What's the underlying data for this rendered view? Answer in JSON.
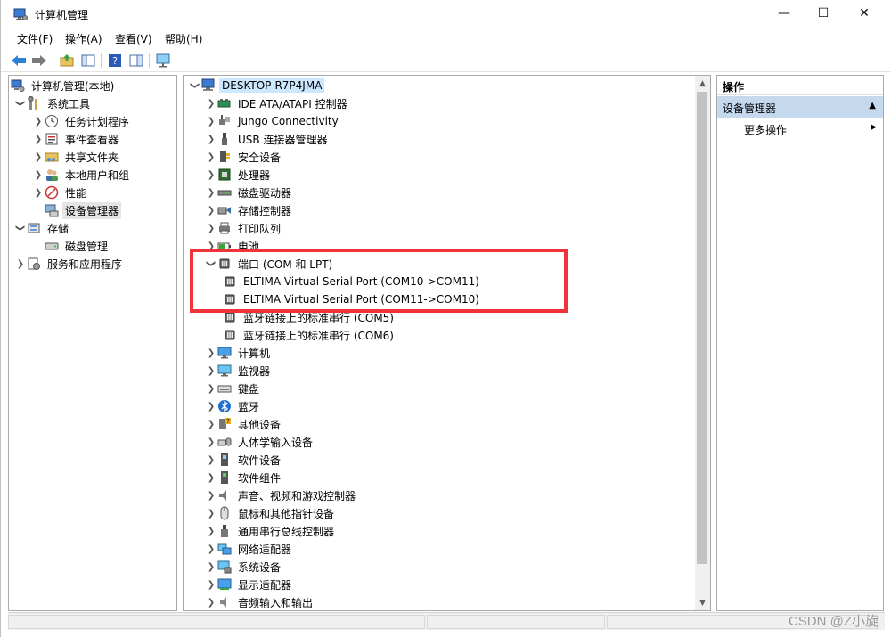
{
  "window": {
    "title": "计算机管理",
    "controls": {
      "minimize": "—",
      "maximize": "☐",
      "close": "✕"
    }
  },
  "menu": [
    "文件(F)",
    "操作(A)",
    "查看(V)",
    "帮助(H)"
  ],
  "toolbar": {
    "icons": [
      "back-arrow-icon",
      "forward-arrow-icon",
      "up-folder-icon",
      "show-hide-tree-icon",
      "help-icon",
      "properties-icon",
      "monitor-icon"
    ]
  },
  "left_tree": [
    {
      "label": "计算机管理(本地)",
      "icon": "computer-manage-icon",
      "level": 0,
      "chevron": "",
      "selected": false
    },
    {
      "label": "系统工具",
      "icon": "tools-icon",
      "level": 1,
      "chevron": "v",
      "selected": false
    },
    {
      "label": "任务计划程序",
      "icon": "clock-icon",
      "level": 2,
      "chevron": ">",
      "selected": false
    },
    {
      "label": "事件查看器",
      "icon": "event-viewer-icon",
      "level": 2,
      "chevron": ">",
      "selected": false
    },
    {
      "label": "共享文件夹",
      "icon": "shared-folder-icon",
      "level": 2,
      "chevron": ">",
      "selected": false
    },
    {
      "label": "本地用户和组",
      "icon": "users-icon",
      "level": 2,
      "chevron": ">",
      "selected": false
    },
    {
      "label": "性能",
      "icon": "performance-icon",
      "level": 2,
      "chevron": ">",
      "selected": false
    },
    {
      "label": "设备管理器",
      "icon": "device-manager-icon",
      "level": 2,
      "chevron": "",
      "selected": true
    },
    {
      "label": "存储",
      "icon": "storage-icon",
      "level": 1,
      "chevron": "v",
      "selected": false
    },
    {
      "label": "磁盘管理",
      "icon": "disk-icon",
      "level": 2,
      "chevron": "",
      "selected": false
    },
    {
      "label": "服务和应用程序",
      "icon": "services-icon",
      "level": 1,
      "chevron": ">",
      "selected": false
    }
  ],
  "device_tree": {
    "root": "DESKTOP-R7P4JMA",
    "items": [
      {
        "label": "IDE ATA/ATAPI 控制器",
        "icon": "ide-icon",
        "level": 1,
        "chevron": ">"
      },
      {
        "label": "Jungo Connectivity",
        "icon": "jungo-icon",
        "level": 1,
        "chevron": ">"
      },
      {
        "label": "USB 连接器管理器",
        "icon": "usb-icon",
        "level": 1,
        "chevron": ">"
      },
      {
        "label": "安全设备",
        "icon": "security-icon",
        "level": 1,
        "chevron": ">"
      },
      {
        "label": "处理器",
        "icon": "cpu-icon",
        "level": 1,
        "chevron": ">"
      },
      {
        "label": "磁盘驱动器",
        "icon": "disk-drive-icon",
        "level": 1,
        "chevron": ">"
      },
      {
        "label": "存储控制器",
        "icon": "storage-controller-icon",
        "level": 1,
        "chevron": ">"
      },
      {
        "label": "打印队列",
        "icon": "printer-icon",
        "level": 1,
        "chevron": ">"
      },
      {
        "label": "电池",
        "icon": "battery-icon",
        "level": 1,
        "chevron": ">"
      },
      {
        "label": "端口 (COM 和 LPT)",
        "icon": "port-icon",
        "level": 1,
        "chevron": "v"
      },
      {
        "label": "ELTIMA Virtual Serial Port (COM10->COM11)",
        "icon": "port-icon",
        "level": 2,
        "chevron": ""
      },
      {
        "label": "ELTIMA Virtual Serial Port (COM11->COM10)",
        "icon": "port-icon",
        "level": 2,
        "chevron": ""
      },
      {
        "label": "蓝牙链接上的标准串行 (COM5)",
        "icon": "port-icon",
        "level": 2,
        "chevron": ""
      },
      {
        "label": "蓝牙链接上的标准串行 (COM6)",
        "icon": "port-icon",
        "level": 2,
        "chevron": ""
      },
      {
        "label": "计算机",
        "icon": "computer-icon",
        "level": 1,
        "chevron": ">"
      },
      {
        "label": "监视器",
        "icon": "monitor-icon",
        "level": 1,
        "chevron": ">"
      },
      {
        "label": "键盘",
        "icon": "keyboard-icon",
        "level": 1,
        "chevron": ">"
      },
      {
        "label": "蓝牙",
        "icon": "bluetooth-icon",
        "level": 1,
        "chevron": ">"
      },
      {
        "label": "其他设备",
        "icon": "other-devices-icon",
        "level": 1,
        "chevron": ">"
      },
      {
        "label": "人体学输入设备",
        "icon": "hid-icon",
        "level": 1,
        "chevron": ">"
      },
      {
        "label": "软件设备",
        "icon": "software-device-icon",
        "level": 1,
        "chevron": ">"
      },
      {
        "label": "软件组件",
        "icon": "software-component-icon",
        "level": 1,
        "chevron": ">"
      },
      {
        "label": "声音、视频和游戏控制器",
        "icon": "speaker-icon",
        "level": 1,
        "chevron": ">"
      },
      {
        "label": "鼠标和其他指针设备",
        "icon": "mouse-icon",
        "level": 1,
        "chevron": ">"
      },
      {
        "label": "通用串行总线控制器",
        "icon": "usb-controller-icon",
        "level": 1,
        "chevron": ">"
      },
      {
        "label": "网络适配器",
        "icon": "network-icon",
        "level": 1,
        "chevron": ">"
      },
      {
        "label": "系统设备",
        "icon": "system-device-icon",
        "level": 1,
        "chevron": ">"
      },
      {
        "label": "显示适配器",
        "icon": "display-adapter-icon",
        "level": 1,
        "chevron": ">"
      },
      {
        "label": "音频输入和输出",
        "icon": "audio-icon",
        "level": 1,
        "chevron": ">"
      }
    ]
  },
  "actions": {
    "title": "操作",
    "section": "设备管理器",
    "section_arrow": "▲",
    "item": "更多操作",
    "item_arrow": "▶"
  },
  "watermark": "CSDN @Z小旋",
  "colors": {
    "highlight_box": "#f0323a",
    "selection": "#cce8ff",
    "actions_header": "#c5d9ee"
  }
}
